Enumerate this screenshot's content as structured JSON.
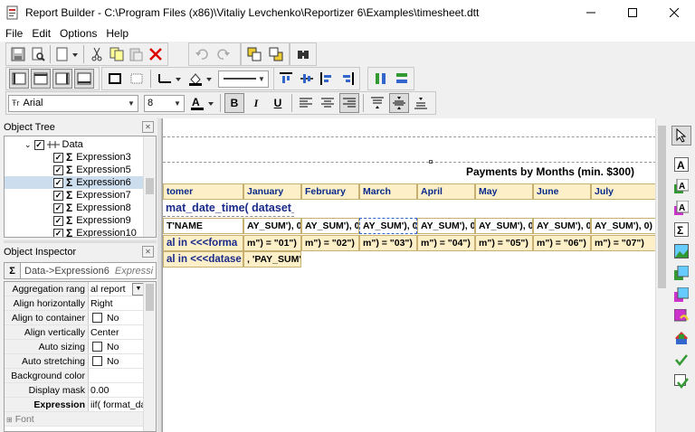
{
  "window": {
    "title": "Report Builder - C:\\Program Files (x86)\\Vitaliy Levchenko\\Reportizer 6\\Examples\\timesheet.dtt"
  },
  "menu": [
    "File",
    "Edit",
    "Options",
    "Help"
  ],
  "font": {
    "name": "Arial",
    "size": "8"
  },
  "object_tree": {
    "title": "Object Tree",
    "root": "Data",
    "items": [
      "Expression3",
      "Expression5",
      "Expression6",
      "Expression7",
      "Expression8",
      "Expression9",
      "Expression10"
    ],
    "selected": "Expression6"
  },
  "inspector": {
    "title": "Object Inspector",
    "object": "Data->Expression6",
    "object_type": "Expressi",
    "rows": [
      {
        "k": "Aggregation rang",
        "v": "al report",
        "combo": true
      },
      {
        "k": "Align horizontally",
        "v": "Right"
      },
      {
        "k": "Align to container",
        "v": "No",
        "check": true
      },
      {
        "k": "Align vertically",
        "v": "Center"
      },
      {
        "k": "Auto sizing",
        "v": "No",
        "check": true
      },
      {
        "k": "Auto stretching",
        "v": "No",
        "check": true
      },
      {
        "k": "Background color",
        "v": ""
      },
      {
        "k": "Display mask",
        "v": "0.00"
      },
      {
        "k": "Expression",
        "v": "iif( format_da",
        "bold": true
      },
      {
        "k": "Font",
        "v": "",
        "group": true
      }
    ]
  },
  "report": {
    "title": "Payments by Months (min. $300)",
    "header_row": [
      "tomer",
      "January",
      "February",
      "March",
      "April",
      "May",
      "June",
      "July"
    ],
    "big_row": [
      "mat_date_time( dataset_f"
    ],
    "name_row": [
      "T'NAME",
      "AY_SUM'), 0)",
      "AY_SUM'), 0)",
      "AY_SUM'), 0)",
      "AY_SUM'), 0)",
      "AY_SUM'), 0)",
      "AY_SUM'), 0)",
      "AY_SUM'), 0)"
    ],
    "month_row": [
      "al in <<<forma",
      "m\") = \"01\")",
      "m\") = \"02\")",
      "m\") = \"03\")",
      "m\") = \"04\")",
      "m\") = \"05\")",
      "m\") = \"06\")",
      "m\") = \"07\")"
    ],
    "total_row": [
      "al in <<<datase",
      ", 'PAY_SUM')"
    ]
  }
}
